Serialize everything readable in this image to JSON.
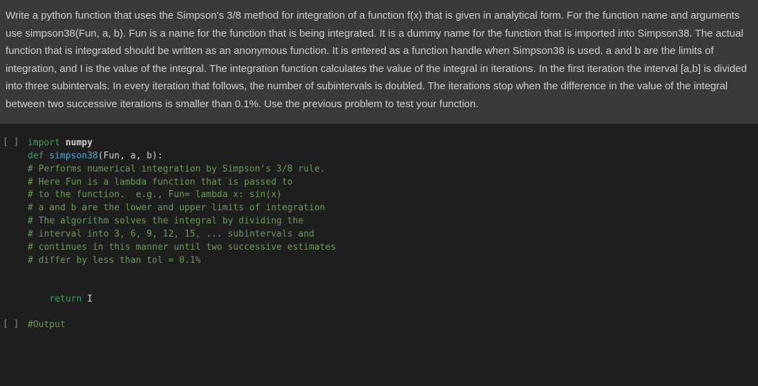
{
  "problem": {
    "text": "Write a python function that uses the Simpson's 3/8 method for integration of a function f(x) that is given in analytical form. For the function name and arguments use simpson38(Fun, a, b). Fun is a name for the function that is being integrated. It is a dummy name for the function that is imported into Simpson38. The actual function that is integrated should be written as an anonymous function. It is entered as a function handle when Simpson38 is used. a and b are the limits of integration, and I is the value of the integral. The integration function calculates the value of the integral in iterations. In the first iteration the interval [a,b] is divided into three subintervals. In every iteration that follows, the number of subintervals is doubled. The iterations stop when the difference in the value of the integral between two successive iterations is smaller than 0.1%. Use the previous problem to test your function."
  },
  "cells": [
    {
      "prompt": "[ ]",
      "code": {
        "kw_import": "import",
        "mod_numpy": "numpy",
        "kw_def": "def",
        "fn_name": "simpson38",
        "open_paren": "(",
        "p1": "Fun",
        "c1": ",",
        "p2": "a",
        "c2": ",",
        "p3": "b",
        "close_paren": "):",
        "comment1": "# Performs numerical integration by Simpson's 3/8 rule.",
        "comment2": "# Here Fun is a lambda function that is passed to",
        "comment3": "# to the function.  e.g., Fun= lambda x: sin(x)",
        "comment4": "# a and b are the lower and upper limits of integration",
        "comment5": "# The algorithm solves the integral by dividing the",
        "comment6": "# interval into 3, 6, 9, 12, 15, ... subintervals and",
        "comment7": "# continues in this manner until two successive estimates",
        "comment8": "# differ by less than tol = 0.1%",
        "kw_return": "return",
        "ret_var": "I"
      }
    },
    {
      "prompt": "[ ]",
      "code": {
        "comment_output": "#Output"
      }
    }
  ]
}
